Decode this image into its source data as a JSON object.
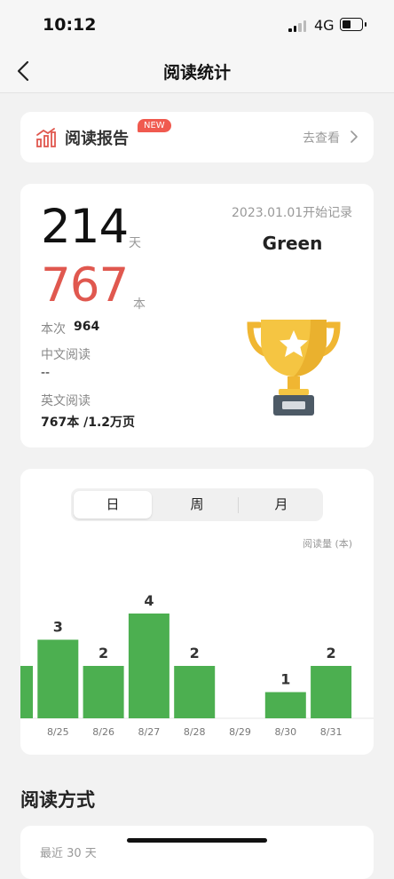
{
  "status": {
    "time": "10:12",
    "network": "4G"
  },
  "nav": {
    "title": "阅读统计"
  },
  "report": {
    "title": "阅读报告",
    "badge": "NEW",
    "link": "去查看"
  },
  "stats": {
    "days": "214",
    "days_unit": "天",
    "books": "767",
    "books_unit": "本",
    "session_label": "本次",
    "session_value": "964",
    "chinese_label": "中文阅读",
    "chinese_value": "--",
    "english_label": "英文阅读",
    "english_value": "767本 /1.2万页",
    "start_date": "2023.01.01开始记录",
    "user_name": "Green"
  },
  "tabs": [
    {
      "label": "日",
      "active": true
    },
    {
      "label": "周",
      "active": false
    },
    {
      "label": "月",
      "active": false
    }
  ],
  "chart_data": {
    "type": "bar",
    "ylabel": "阅读量 (本)",
    "categories": [
      "",
      "8/25",
      "8/26",
      "8/27",
      "8/28",
      "8/29",
      "8/30",
      "8/31"
    ],
    "values": [
      2,
      3,
      2,
      4,
      2,
      0,
      1,
      2
    ],
    "labels": [
      "",
      "3",
      "2",
      "4",
      "2",
      "",
      "1",
      "2"
    ],
    "color": "#4caf50"
  },
  "section": {
    "title": "阅读方式",
    "recent": "最近 30 天"
  }
}
